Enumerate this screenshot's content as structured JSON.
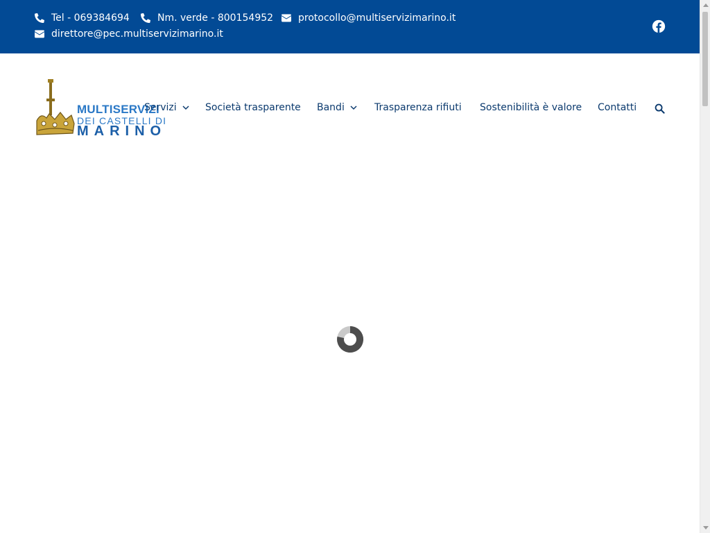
{
  "topbar": {
    "background": "#024a95",
    "contacts": [
      {
        "icon": "phone-icon",
        "text": "Tel - 069384694"
      },
      {
        "icon": "phone-icon",
        "text": "Nm. verde - 800154952"
      },
      {
        "icon": "envelope-icon",
        "text": "protocollo@multiservizimarino.it"
      },
      {
        "icon": "envelope-icon",
        "text": "direttore@pec.multiservizimarino.it"
      }
    ],
    "social": {
      "icon": "facebook-icon"
    }
  },
  "logo": {
    "line1": "MULTISERVIZI",
    "line2": "DEI CASTELLI DI",
    "line3": "MARINO"
  },
  "nav": {
    "items": [
      {
        "label": "Servizi",
        "has_dropdown": true
      },
      {
        "label": "Società trasparente",
        "has_dropdown": false
      },
      {
        "label": "Bandi",
        "has_dropdown": true
      },
      {
        "label": "Trasparenza rifiuti",
        "has_dropdown": false
      },
      {
        "label": "Sostenibilità è valore",
        "has_dropdown": false
      },
      {
        "label": "Contatti",
        "has_dropdown": false
      }
    ],
    "search_icon": "search-icon",
    "text_color": "#0b3a6e"
  },
  "main": {
    "loader_icon": "loading-spinner-icon"
  }
}
